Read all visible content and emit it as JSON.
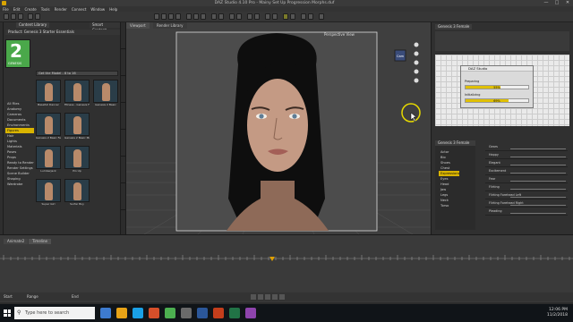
{
  "window": {
    "title": "DAZ Studio 4.10 Pro - Mainy Set Up Progression Morphs.duf",
    "minimize_glyph": "—",
    "maximize_glyph": "□",
    "close_glyph": "✕"
  },
  "menu": [
    "File",
    "Edit",
    "Create",
    "Tools",
    "Render",
    "Connect",
    "Window",
    "Help"
  ],
  "content_library": {
    "tab_label": "Content Library",
    "search_label": "Smart Content",
    "path_label": "Product: Genesis 3 Starter Essentials",
    "logo_number": "2",
    "logo_text": "GENESIS",
    "filter_label": "Get the Model - 8 to 16",
    "tree": [
      {
        "label": "All Files",
        "selected": false
      },
      {
        "label": "Anatomy",
        "selected": false
      },
      {
        "label": "Cameras",
        "selected": false
      },
      {
        "label": "Documents",
        "selected": false
      },
      {
        "label": "Environments",
        "selected": false
      },
      {
        "label": "Figures",
        "selected": true
      },
      {
        "label": "Hair",
        "selected": false
      },
      {
        "label": "Lights",
        "selected": false
      },
      {
        "label": "Materials",
        "selected": false
      },
      {
        "label": "Poses",
        "selected": false
      },
      {
        "label": "Props",
        "selected": false
      },
      {
        "label": "Ready to Render",
        "selected": false
      },
      {
        "label": "Render Settings",
        "selected": false
      },
      {
        "label": "Scene Builder",
        "selected": false
      },
      {
        "label": "Shaping",
        "selected": false
      },
      {
        "label": "Wardrobe",
        "selected": false
      }
    ],
    "thumbnails": [
      {
        "label": "Basefull Dancer"
      },
      {
        "label": "Fitness - Genesis Female"
      },
      {
        "label": "Genesis 2 Basic"
      },
      {
        "label": "Genesis 2 Basic Female"
      },
      {
        "label": "Genesis 2 Basic Male"
      },
      {
        "label": ""
      },
      {
        "label": "Lumberjack"
      },
      {
        "label": "Pin Up"
      },
      {
        "label": ""
      },
      {
        "label": "Super Girl"
      },
      {
        "label": "Surfer Boy"
      },
      {
        "label": ""
      }
    ]
  },
  "viewport": {
    "tabs": [
      "Viewport",
      "Render Library"
    ],
    "camera_label": "Perspective View",
    "cam_cube_label": "Cam"
  },
  "right_panel": {
    "tabs": [
      "Genesis 3 Female"
    ],
    "progress": {
      "title": "DAZ Studio",
      "label1": "Preparing",
      "value1": 0.55,
      "label2": "Initializing",
      "value2": 0.69
    },
    "parameters_title": "Genesis 3 Female",
    "tree_items": [
      "Actor",
      "Bio",
      "Shoes",
      "Chest",
      "Expressions",
      "Eyes",
      "Head",
      "Jaw",
      "Legs",
      "Neck",
      "Torso"
    ],
    "param_rows": [
      "Gears",
      "Happy",
      "Elegant",
      "Excitement",
      "Fear",
      "Flirting",
      "Flirting Forehead Left",
      "Flirting Forehead Right",
      "Pleading"
    ]
  },
  "timeline": {
    "tabs": [
      "Animate2",
      "Timeline"
    ],
    "start_label": "Start",
    "end_label": "End",
    "range_label": "Range"
  },
  "taskbar": {
    "search_placeholder": "Type here to search",
    "time": "12:06 PM",
    "date": "11/2/2018"
  }
}
